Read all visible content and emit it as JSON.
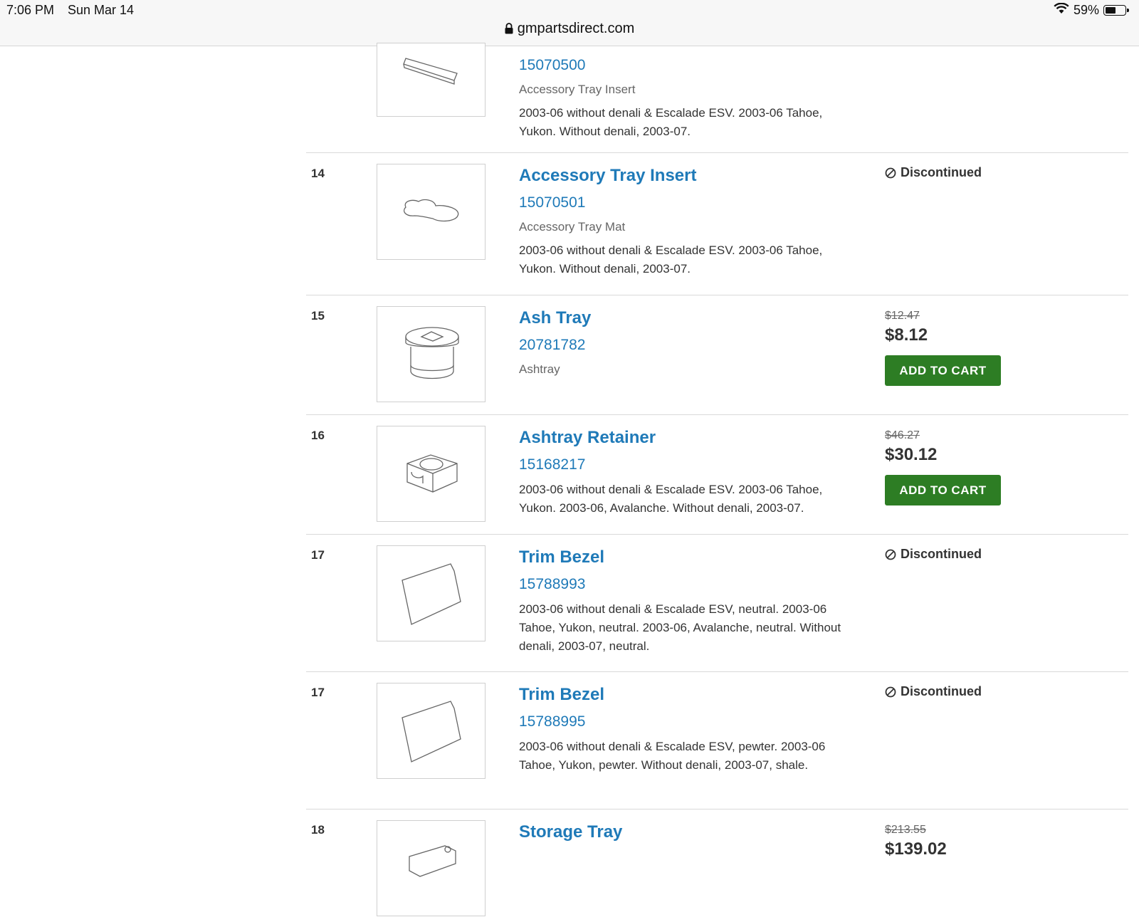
{
  "status_bar": {
    "time": "7:06 PM",
    "date": "Sun Mar 14",
    "battery": "59%",
    "battery_level": 0.59,
    "url": "gmpartsdirect.com"
  },
  "parts": [
    {
      "ref": "",
      "name": "",
      "part_number": "15070500",
      "subtitle": "Accessory Tray Insert",
      "description": "2003-06 without denali & Escalade ESV. 2003-06 Tahoe, Yukon. Without denali, 2003-07.",
      "status": "",
      "icon": "flat-strip-icon"
    },
    {
      "ref": "14",
      "name": "Accessory Tray Insert",
      "part_number": "15070501",
      "subtitle": "Accessory Tray Mat",
      "description": "2003-06 without denali & Escalade ESV. 2003-06 Tahoe, Yukon. Without denali, 2003-07.",
      "status": "Discontinued",
      "icon": "tray-mat-icon"
    },
    {
      "ref": "15",
      "name": "Ash Tray",
      "part_number": "20781782",
      "subtitle": "Ashtray",
      "description": "",
      "was_price": "$12.47",
      "price": "$8.12",
      "button": "ADD TO CART",
      "icon": "ashtray-icon"
    },
    {
      "ref": "16",
      "name": "Ashtray Retainer",
      "part_number": "15168217",
      "subtitle": "",
      "description": "2003-06 without denali & Escalade ESV. 2003-06 Tahoe, Yukon. 2003-06, Avalanche. Without denali, 2003-07.",
      "was_price": "$46.27",
      "price": "$30.12",
      "button": "ADD TO CART",
      "icon": "retainer-icon"
    },
    {
      "ref": "17",
      "name": "Trim Bezel",
      "part_number": "15788993",
      "subtitle": "",
      "description": "2003-06 without denali & Escalade ESV, neutral. 2003-06 Tahoe, Yukon, neutral. 2003-06, Avalanche, neutral. Without denali, 2003-07, neutral.",
      "status": "Discontinued",
      "icon": "bezel-icon"
    },
    {
      "ref": "17",
      "name": "Trim Bezel",
      "part_number": "15788995",
      "subtitle": "",
      "description": "2003-06 without denali & Escalade ESV, pewter. 2003-06 Tahoe, Yukon, pewter. Without denali, 2003-07, shale.",
      "status": "Discontinued",
      "icon": "bezel-icon"
    },
    {
      "ref": "18",
      "name": "Storage Tray",
      "part_number": "",
      "subtitle": "",
      "description": "",
      "was_price": "$213.55",
      "price": "$139.02",
      "icon": "storage-tray-icon"
    }
  ],
  "colors": {
    "link": "#1f7ab8",
    "cart_button": "#2d7d24",
    "divider": "#d9d9d9"
  }
}
